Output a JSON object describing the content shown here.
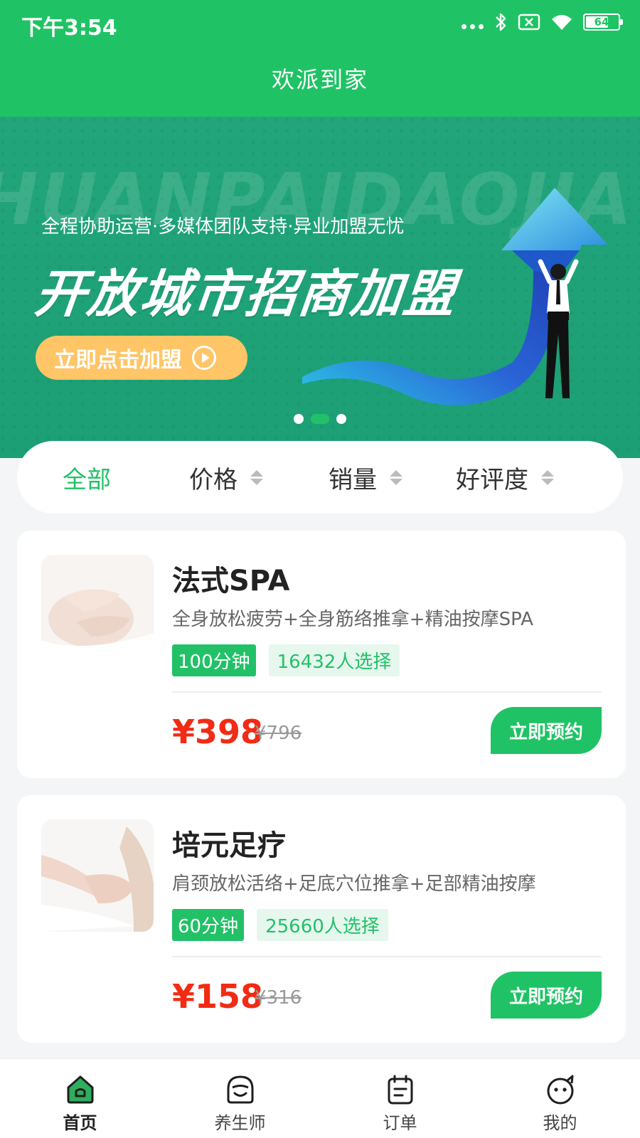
{
  "status_bar": {
    "time": "下午3:54",
    "battery": "64",
    "icons": [
      "signal-dots-icon",
      "bluetooth-icon",
      "sim-off-icon",
      "wifi-icon",
      "battery-icon"
    ]
  },
  "header": {
    "title": "欢派到家"
  },
  "banner": {
    "watermark": "HUANPAIDAOJIA",
    "subtitle": "全程协助运营·多媒体团队支持·异业加盟无忧",
    "headline": "开放城市招商加盟",
    "button_label": "立即点击加盟",
    "slide_count": 3,
    "active_slide": 2
  },
  "filters": [
    {
      "label": "全部",
      "active": true,
      "sortable": false
    },
    {
      "label": "价格",
      "active": false,
      "sortable": true
    },
    {
      "label": "销量",
      "active": false,
      "sortable": true
    },
    {
      "label": "好评度",
      "active": false,
      "sortable": true
    }
  ],
  "services": [
    {
      "name": "法式SPA",
      "description": "全身放松疲劳+全身筋络推拿+精油按摩SPA",
      "duration": "100分钟",
      "choices": "16432人选择",
      "price": "¥398",
      "original_price": "¥796",
      "book_label": "立即预约"
    },
    {
      "name": "培元足疗",
      "description": "肩颈放松活络+足底穴位推拿+足部精油按摩",
      "duration": "60分钟",
      "choices": "25660人选择",
      "price": "¥158",
      "original_price": "¥316",
      "book_label": "立即预约"
    }
  ],
  "tabbar": [
    {
      "label": "首页",
      "icon": "home-icon",
      "active": true
    },
    {
      "label": "养生师",
      "icon": "therapist-icon",
      "active": false
    },
    {
      "label": "订单",
      "icon": "order-icon",
      "active": false
    },
    {
      "label": "我的",
      "icon": "profile-icon",
      "active": false
    }
  ],
  "colors": {
    "brand_green": "#1fc365",
    "banner_green": "#22a57a",
    "price_red": "#f22b14",
    "join_button": "#ffc566"
  }
}
